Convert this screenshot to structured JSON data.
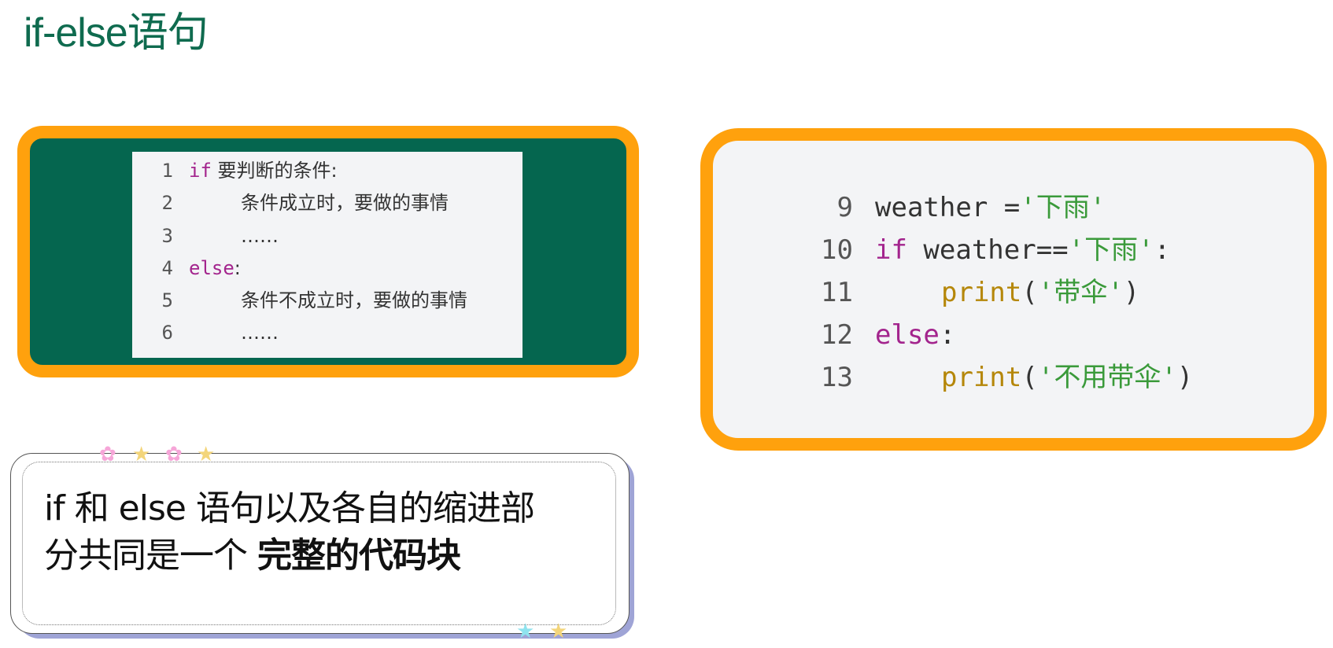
{
  "title": "if-else语句",
  "left_code": {
    "lines": [
      {
        "num": "1",
        "keyword": "if",
        "text": " 要判断的条件:"
      },
      {
        "num": "2",
        "keyword": "",
        "text": "条件成立时，要做的事情"
      },
      {
        "num": "3",
        "keyword": "",
        "text": "……"
      },
      {
        "num": "4",
        "keyword": "else",
        "text": ":"
      },
      {
        "num": "5",
        "keyword": "",
        "text": "条件不成立时，要做的事情"
      },
      {
        "num": "6",
        "keyword": "",
        "text": "……"
      }
    ]
  },
  "right_code": {
    "lines": [
      {
        "num": "9",
        "parts": [
          "weather =",
          "'下雨'"
        ]
      },
      {
        "num": "10",
        "parts": [
          "if",
          " weather==",
          "'下雨'",
          ":"
        ]
      },
      {
        "num": "11",
        "parts": [
          "print",
          "(",
          "'带伞'",
          ")"
        ]
      },
      {
        "num": "12",
        "parts": [
          "else",
          ":"
        ]
      },
      {
        "num": "13",
        "parts": [
          "print",
          "(",
          "'不用带伞'",
          ")"
        ]
      }
    ]
  },
  "note": {
    "line1": "if 和 else 语句以及各自的缩进部",
    "line2_plain": "分共同是一个 ",
    "line2_bold": "完整的代码块"
  },
  "colors": {
    "title": "#0f6b4f",
    "board": "#05664f",
    "frame": "#ffa10d",
    "keyword": "#a3248d",
    "function": "#b5870a",
    "string": "#3a9a3a",
    "note_shadow": "#9fa4d6"
  },
  "decorations": [
    "flower-icon",
    "star-icon"
  ]
}
